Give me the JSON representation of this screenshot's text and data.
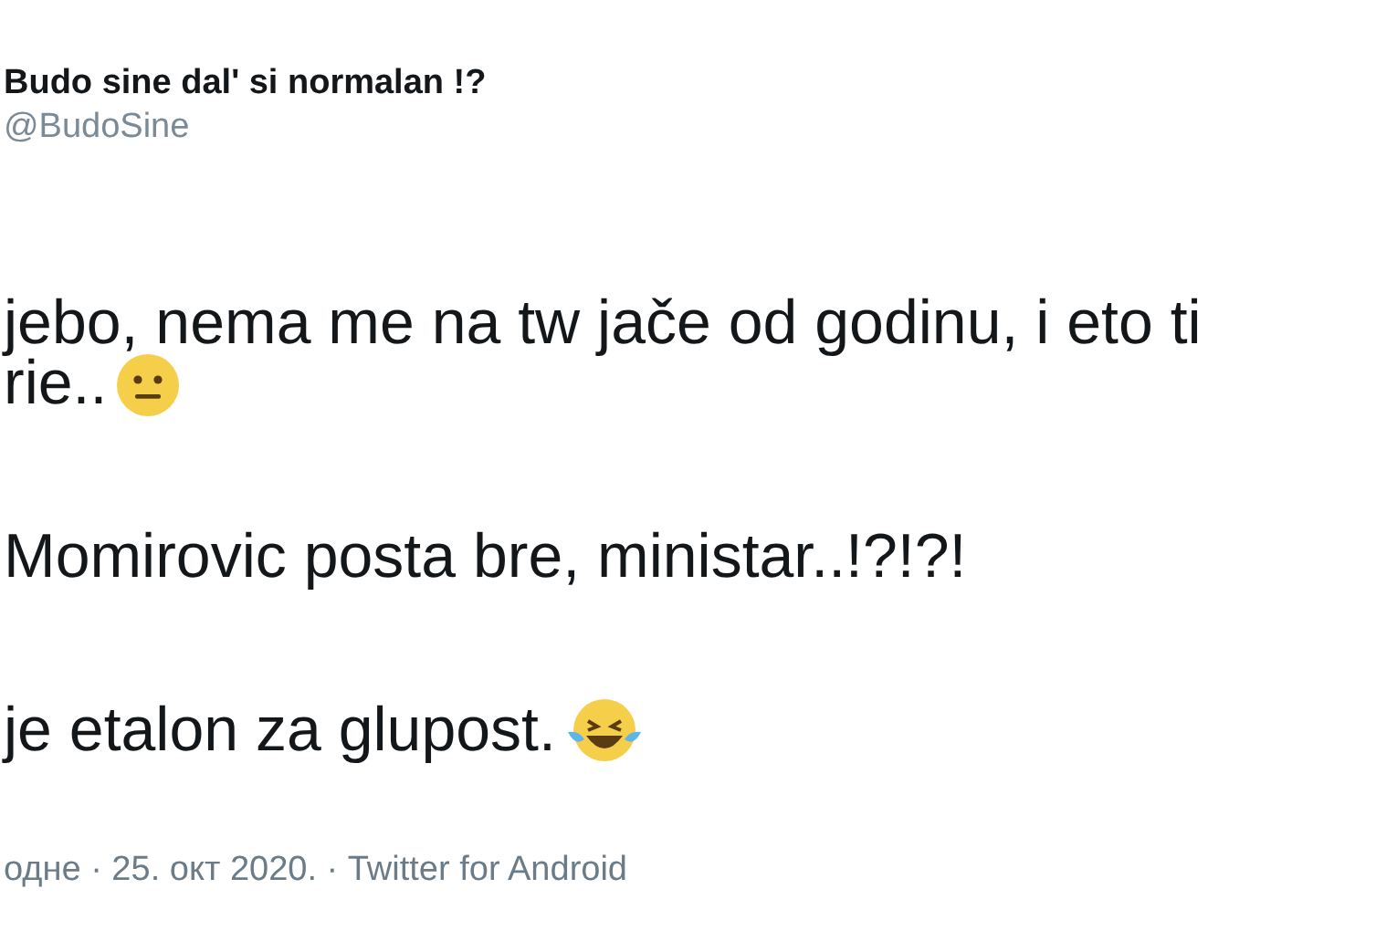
{
  "tweet": {
    "author_name": "Budo sine dal' si normalan !?",
    "handle": "@BudoSine",
    "paragraphs": [
      {
        "lines": [
          {
            "text": "jebo, nema me na tw jače od godinu, i eto ti",
            "kind": "plain"
          },
          {
            "text": "rie..",
            "kind": "neutral"
          }
        ]
      },
      {
        "lines": [
          {
            "text": "Momirovic posta bre, ministar..!?!?!",
            "kind": "plain"
          }
        ]
      },
      {
        "lines": [
          {
            "text": "je etalon za glupost.",
            "kind": "laughing"
          }
        ]
      }
    ],
    "meta": "одне · 25. окт 2020. · Twitter for Android"
  }
}
